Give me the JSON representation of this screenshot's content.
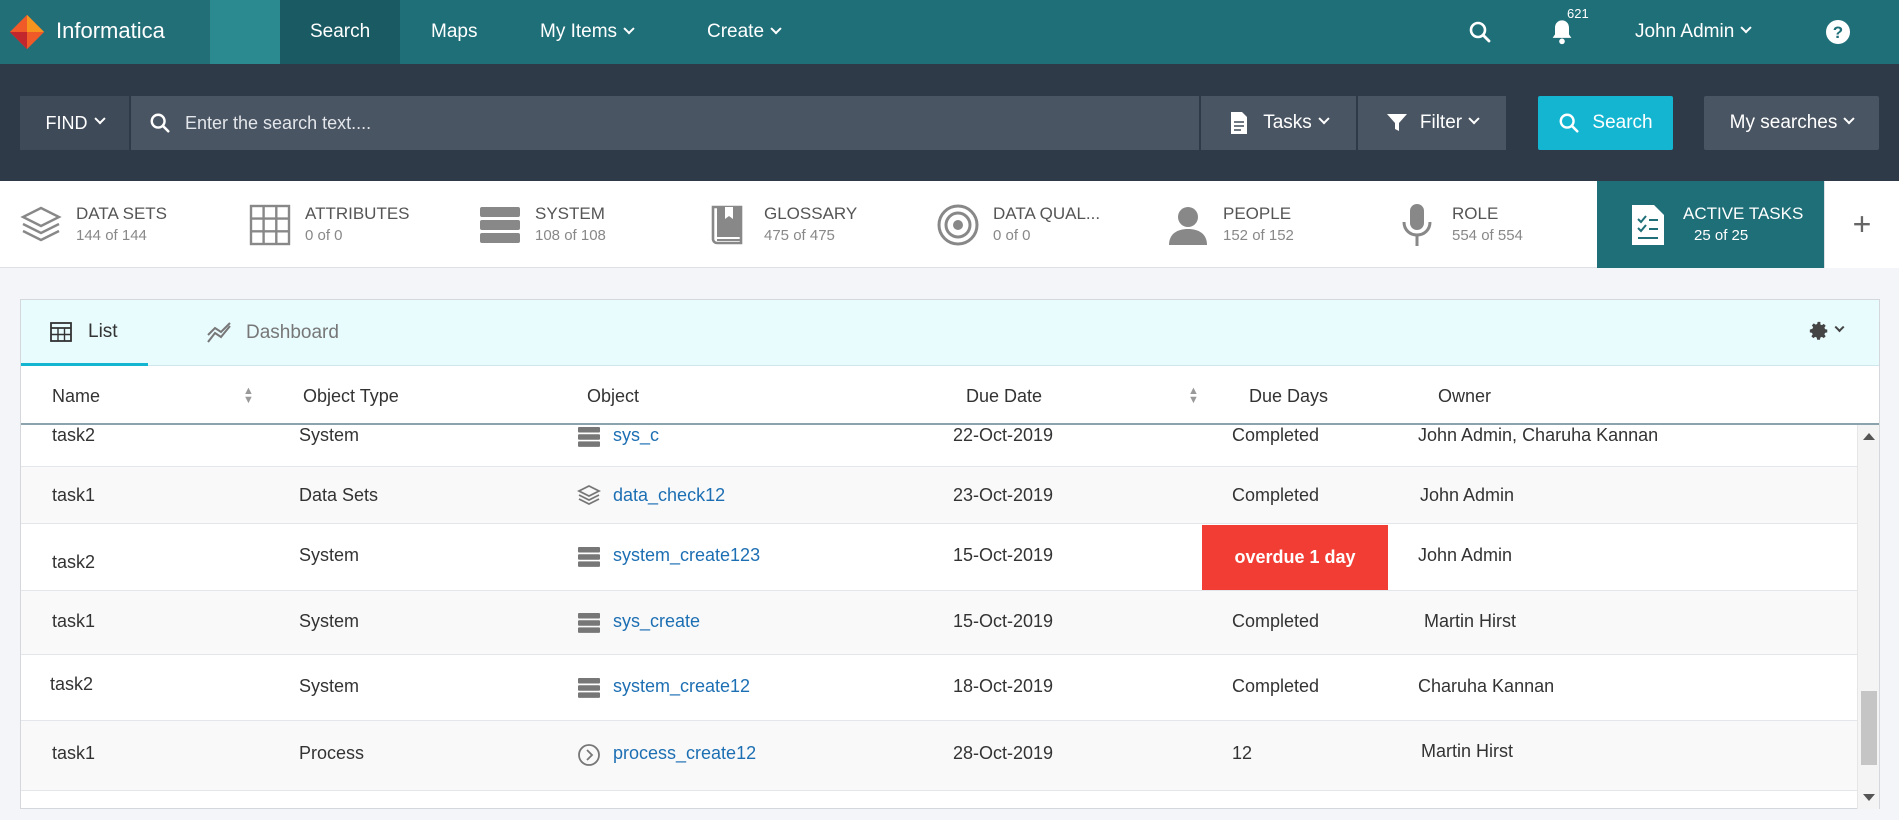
{
  "brand": {
    "name": "Informatica",
    "color": "#1f6f78",
    "logo_color": "#f05a28"
  },
  "nav": {
    "items": [
      {
        "label": "Search",
        "active": true
      },
      {
        "label": "Maps"
      },
      {
        "label": "My Items"
      },
      {
        "label": "Create"
      }
    ],
    "notifications_count": "621",
    "user": "John Admin"
  },
  "findbar": {
    "find_label": "FIND",
    "search_placeholder": "Enter the search text....",
    "tasks_label": "Tasks",
    "filter_label": "Filter",
    "search_button": "Search",
    "my_searches": "My searches"
  },
  "categories": [
    {
      "label": "DATA SETS",
      "count": "144 of 144",
      "icon": "layers-icon"
    },
    {
      "label": "ATTRIBUTES",
      "count": "0 of 0",
      "icon": "grid-icon"
    },
    {
      "label": "SYSTEM",
      "count": "108 of 108",
      "icon": "server-icon"
    },
    {
      "label": "GLOSSARY",
      "count": "475 of 475",
      "icon": "book-icon"
    },
    {
      "label": "DATA QUAL...",
      "count": "0 of 0",
      "icon": "target-icon"
    },
    {
      "label": "PEOPLE",
      "count": "152 of 152",
      "icon": "person-icon"
    },
    {
      "label": "ROLE",
      "count": "554 of 554",
      "icon": "microphone-icon"
    },
    {
      "label": "ACTIVE TASKS",
      "count": "25 of 25",
      "icon": "task-document-icon",
      "active": true
    }
  ],
  "tabs": [
    {
      "label": "List",
      "active": true,
      "icon": "table-icon"
    },
    {
      "label": "Dashboard",
      "icon": "chart-line-icon"
    }
  ],
  "table": {
    "columns": [
      "Name",
      "Object Type",
      "Object",
      "Due Date",
      "Due Days",
      "Owner"
    ],
    "rows": [
      {
        "name": "task2",
        "type": "System",
        "object": "sys_c",
        "icon": "server-icon",
        "due_date": "22-Oct-2019",
        "due_days": "Completed",
        "owner": "John Admin, Charuha Kannan"
      },
      {
        "name": "task1",
        "type": "Data Sets",
        "object": "data_check12",
        "icon": "layers-icon",
        "due_date": "23-Oct-2019",
        "due_days": "Completed",
        "owner": "John Admin"
      },
      {
        "name": "task2",
        "type": "System",
        "object": "system_create123",
        "icon": "server-icon",
        "due_date": "15-Oct-2019",
        "due_days": "overdue 1 day",
        "overdue": true,
        "owner": "John Admin"
      },
      {
        "name": "task1",
        "type": "System",
        "object": "sys_create",
        "icon": "server-icon",
        "due_date": "15-Oct-2019",
        "due_days": "Completed",
        "owner": "Martin Hirst"
      },
      {
        "name": "task2",
        "type": "System",
        "object": "system_create12",
        "icon": "server-icon",
        "due_date": "18-Oct-2019",
        "due_days": "Completed",
        "owner": "Charuha Kannan"
      },
      {
        "name": "task1",
        "type": "Process",
        "object": "process_create12",
        "icon": "process-icon",
        "due_date": "28-Oct-2019",
        "due_days": "12",
        "owner": "Martin Hirst"
      }
    ]
  }
}
